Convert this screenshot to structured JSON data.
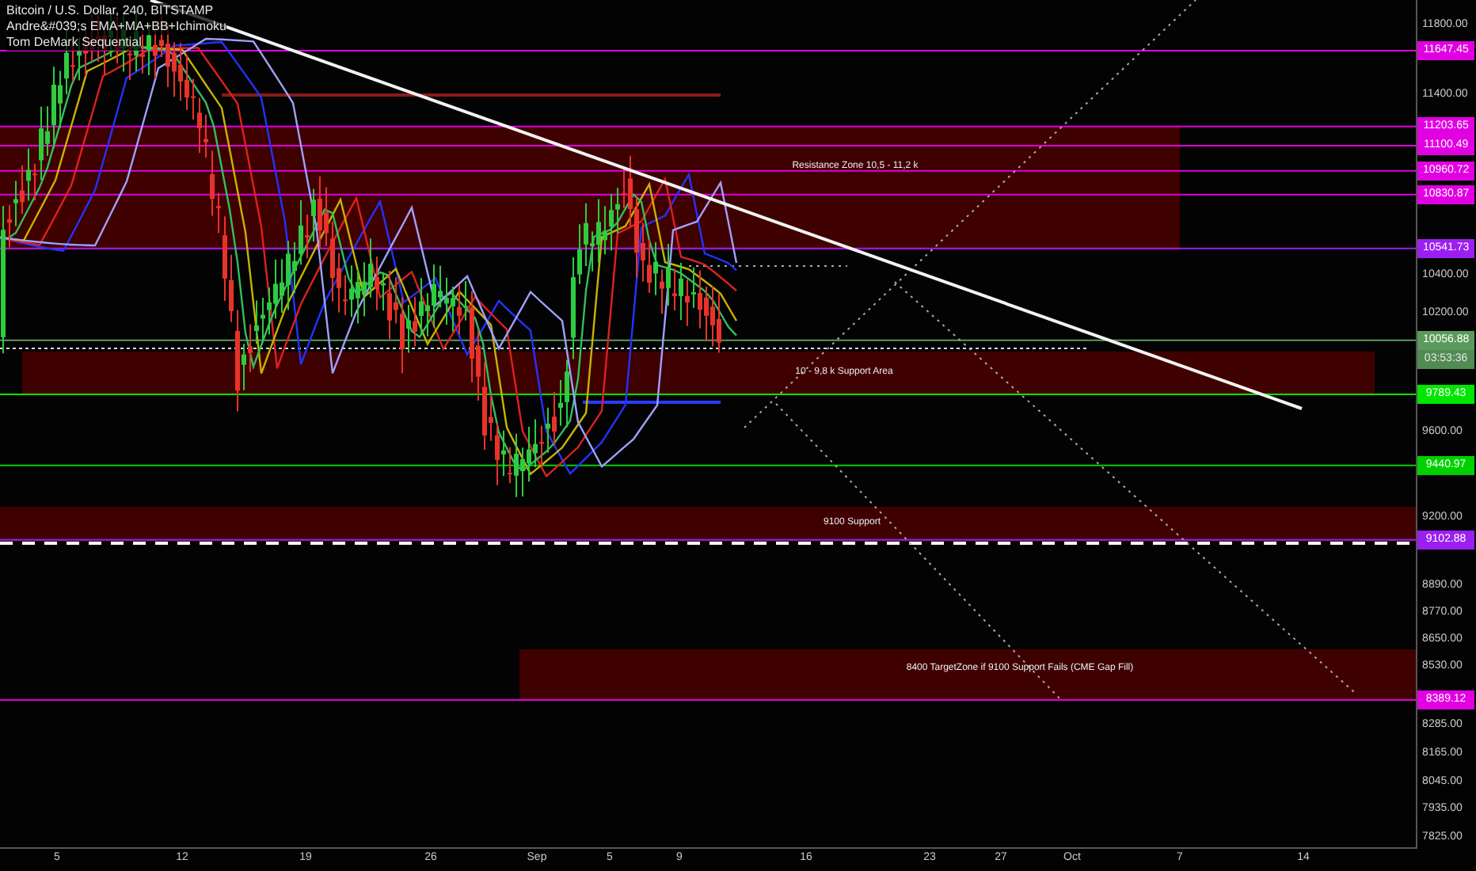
{
  "legend": [
    "Bitcoin / U.S. Dollar, 240, BITSTAMP",
    "Andre&#039;s EMA+MA+BB+Ichimoku",
    "Tom DeMark Sequential"
  ],
  "zones": [
    {
      "label": "Resistance Zone 10,5 - 11,2 k"
    },
    {
      "label": "10 - 9,8 k Support Area"
    },
    {
      "label": "9100 Support"
    },
    {
      "label": "8400 TargetZone if 9100 Support Fails (CME Gap Fill)"
    }
  ],
  "price_tags": [
    {
      "price": "11647.45",
      "color": "#e100e1"
    },
    {
      "price": "11203.65",
      "color": "#e100e1"
    },
    {
      "price": "11100.49",
      "color": "#e100e1"
    },
    {
      "price": "10960.72",
      "color": "#e100e1"
    },
    {
      "price": "10830.87",
      "color": "#e100e1"
    },
    {
      "price": "10541.73",
      "color": "#9b1ff0"
    },
    {
      "price": "10056.88",
      "color": "#5a9a5a",
      "countdown": "03:53:36"
    },
    {
      "price": "9789.43",
      "color": "#00e600"
    },
    {
      "price": "9440.97",
      "color": "#00d000"
    },
    {
      "price": "9102.88",
      "color": "#9b1ff0"
    },
    {
      "price": "8389.12",
      "color": "#e100e1"
    }
  ],
  "price_axis": [
    "11800.00",
    "11400.00",
    "10400.00",
    "10200.00",
    "9600.00",
    "9200.00",
    "8890.00",
    "8770.00",
    "8650.00",
    "8530.00",
    "8285.00",
    "8165.00",
    "8045.00",
    "7935.00",
    "7825.00"
  ],
  "time_axis": [
    "5",
    "12",
    "19",
    "26",
    "Sep",
    "5",
    "9",
    "16",
    "23",
    "27",
    "Oct",
    "7",
    "14"
  ]
}
